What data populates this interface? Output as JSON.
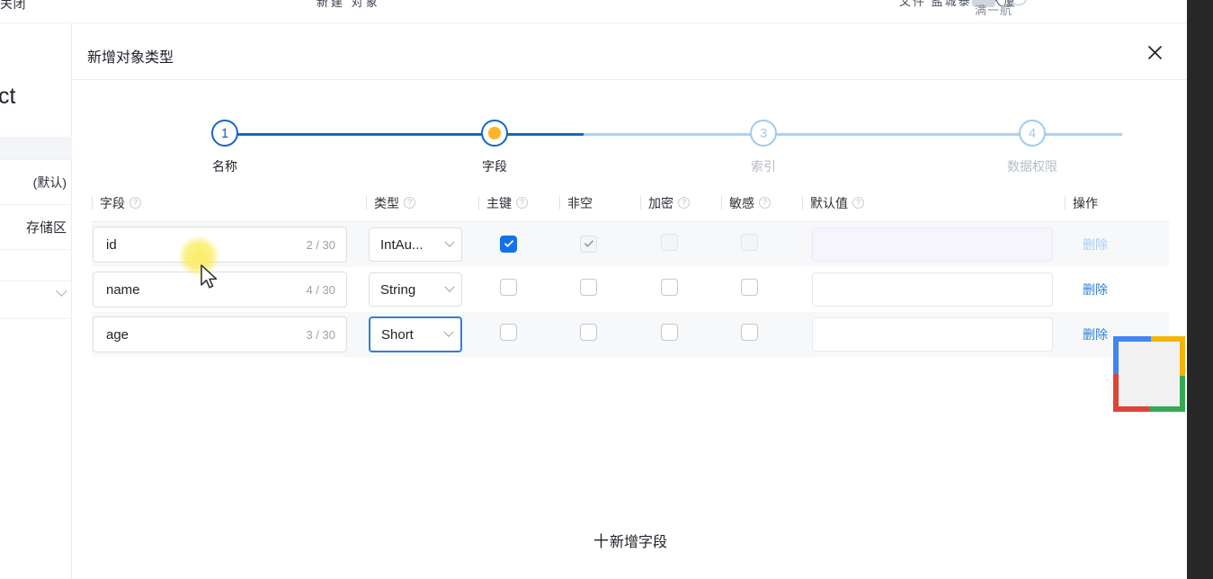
{
  "background": {
    "top_left_text": "关闭",
    "top_mid_text": "新建  对象",
    "top_right_text": "文件 盐城泰权 大厦",
    "username": "满一航",
    "left_title": "ct",
    "left_rows": [
      {
        "label": ""
      },
      {
        "label": "(默认)"
      },
      {
        "label": "存储区"
      },
      {
        "label": ""
      },
      {
        "label": ""
      }
    ]
  },
  "modal": {
    "title": "新增对象类型",
    "close_icon": "close-icon"
  },
  "stepper": {
    "steps": [
      {
        "num": "1",
        "label": "名称",
        "state": "done"
      },
      {
        "num": "2",
        "label": "字段",
        "state": "active"
      },
      {
        "num": "3",
        "label": "索引",
        "state": "todo"
      },
      {
        "num": "4",
        "label": "数据权限",
        "state": "todo"
      }
    ],
    "colors": {
      "done": "#1667c4",
      "active_dot": "#fdb528",
      "todo": "#9ecbf0"
    }
  },
  "table": {
    "headers": [
      {
        "label": "字段",
        "help": true
      },
      {
        "label": "类型",
        "help": true
      },
      {
        "label": "主键",
        "help": true
      },
      {
        "label": "非空",
        "help": false
      },
      {
        "label": "加密",
        "help": true
      },
      {
        "label": "敏感",
        "help": true
      },
      {
        "label": "默认值",
        "help": true
      },
      {
        "label": "操作",
        "help": false
      }
    ],
    "rows": [
      {
        "field": "id",
        "counter": "2 / 30",
        "type": "IntAu...",
        "primary_key": true,
        "pk_disabled": false,
        "not_null": true,
        "nn_disabled": true,
        "encrypt": false,
        "enc_disabled": true,
        "sensitive": false,
        "sen_disabled": true,
        "default_value": "",
        "default_disabled": true,
        "action": "删除",
        "action_disabled": true,
        "type_focused": false
      },
      {
        "field": "name",
        "counter": "4 / 30",
        "type": "String",
        "primary_key": false,
        "pk_disabled": false,
        "not_null": false,
        "nn_disabled": false,
        "encrypt": false,
        "enc_disabled": false,
        "sensitive": false,
        "sen_disabled": false,
        "default_value": "",
        "default_disabled": false,
        "action": "删除",
        "action_disabled": false,
        "type_focused": false
      },
      {
        "field": "age",
        "counter": "3 / 30",
        "type": "Short",
        "primary_key": false,
        "pk_disabled": false,
        "not_null": false,
        "nn_disabled": false,
        "encrypt": false,
        "enc_disabled": false,
        "sensitive": false,
        "sen_disabled": false,
        "default_value": "",
        "default_disabled": false,
        "action": "删除",
        "action_disabled": false,
        "type_focused": true
      }
    ],
    "add_field": {
      "plus": "十",
      "label": "新增字段"
    },
    "field_placeholder": "",
    "default_placeholder": ""
  },
  "overlay": {
    "capture_box_colors": [
      "#4285f4",
      "#f4b400",
      "#34a853",
      "#db4437"
    ]
  }
}
